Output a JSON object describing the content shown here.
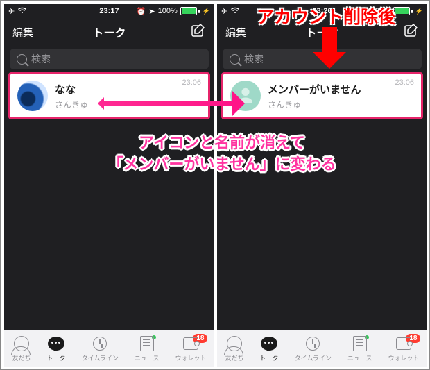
{
  "annotations": {
    "title": "アカウント削除後",
    "caption_l1": "アイコンと名前が消えて",
    "caption_l2": "「メンバーがいません」に変わる"
  },
  "left": {
    "status": {
      "time": "23:17",
      "battery_pct": "100%"
    },
    "nav": {
      "edit": "編集",
      "title": "トーク"
    },
    "search": {
      "placeholder": "検索"
    },
    "row": {
      "name": "なな",
      "sub": "さんきゅ",
      "time": "23:06"
    },
    "tabs": {
      "friends": "友だち",
      "talk": "トーク",
      "timeline": "タイムライン",
      "news": "ニュース",
      "wallet": "ウォレット",
      "wallet_badge": "18"
    }
  },
  "right": {
    "status": {
      "time": "23:20",
      "battery_pct": "100%"
    },
    "nav": {
      "edit": "編集",
      "title": "トーク"
    },
    "search": {
      "placeholder": "検索"
    },
    "row": {
      "name": "メンバーがいません",
      "sub": "さんきゅ",
      "time": "23:06"
    },
    "tabs": {
      "friends": "友だち",
      "talk": "トーク",
      "timeline": "タイムライン",
      "news": "ニュース",
      "wallet": "ウォレット",
      "wallet_badge": "18"
    }
  }
}
